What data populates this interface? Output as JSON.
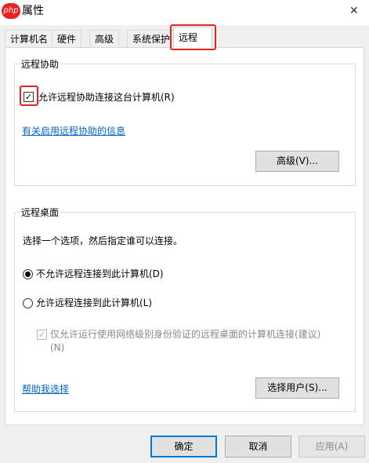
{
  "titlebar": {
    "logo_text": "php",
    "title": "属性",
    "close_glyph": "✕"
  },
  "tabs": [
    {
      "label": "计算机名",
      "active": false
    },
    {
      "label": "硬件",
      "active": false
    },
    {
      "label": "高级",
      "active": false
    },
    {
      "label": "系统保护",
      "active": false
    },
    {
      "label": "远程",
      "active": true
    }
  ],
  "remote_assistance": {
    "group_title": "远程协助",
    "allow_checkbox_label": "允许远程协助连接这台计算机(R)",
    "allow_checked": true,
    "info_link": "有关启用远程协助的信息",
    "advanced_button": "高级(V)..."
  },
  "remote_desktop": {
    "group_title": "远程桌面",
    "instruction": "选择一个选项，然后指定谁可以连接。",
    "option_deny": "不允许远程连接到此计算机(D)",
    "option_allow": "允许远程连接到此计算机(L)",
    "selected_option": "deny",
    "nla_line1": "仅允许运行使用网络级别身份验证的远程桌面的计算机连接(建议)",
    "nla_line2": "(N)",
    "nla_checked": true,
    "help_link": "帮助我选择",
    "select_users_button": "选择用户(S)..."
  },
  "footer": {
    "ok": "确定",
    "cancel": "取消",
    "apply": "应用(A)"
  },
  "colors": {
    "highlight": "#e8231e",
    "link": "#0066cc",
    "primary_border": "#0078d7"
  }
}
